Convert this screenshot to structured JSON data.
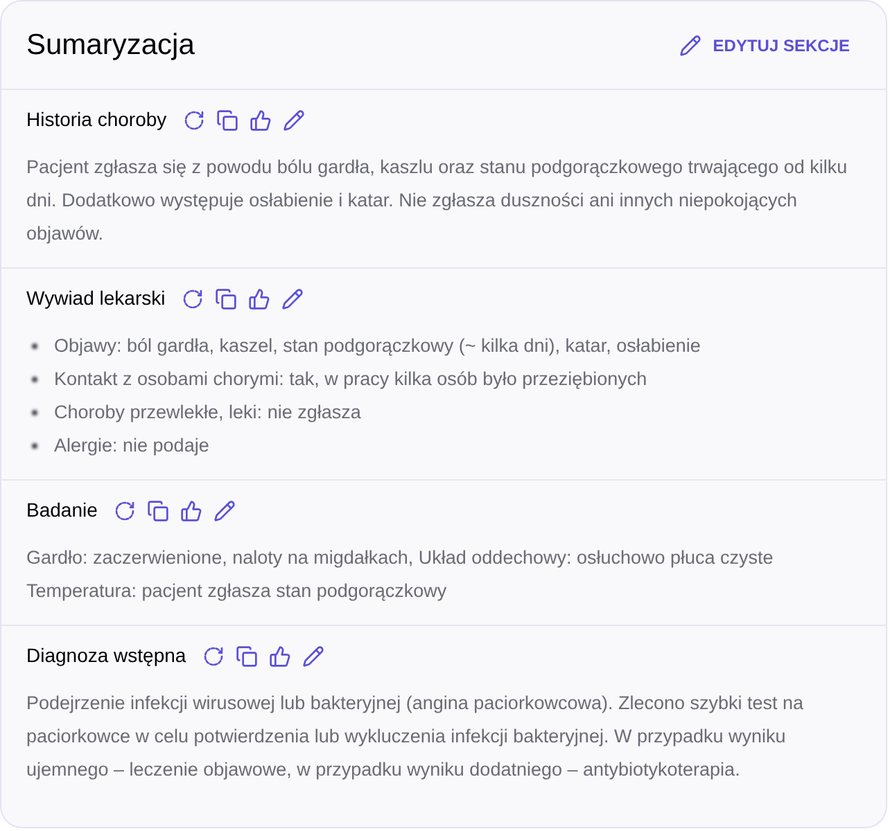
{
  "header": {
    "title": "Sumaryzacja",
    "edit_button": "EDYTUJ SEKCJE"
  },
  "sections": [
    {
      "title": "Historia choroby",
      "kind": "paragraph",
      "text": "Pacjent zgłasza się z powodu bólu gardła, kaszlu oraz stanu podgorączkowego trwającego od kilku dni. Dodatkowo występuje osłabienie i katar. Nie zgłasza duszności ani innych niepokojących objawów."
    },
    {
      "title": "Wywiad lekarski",
      "kind": "list",
      "items": [
        "Objawy: ból gardła, kaszel, stan podgorączkowy (~ kilka dni), katar, osłabienie",
        "Kontakt z osobami chorymi: tak, w pracy kilka osób było przeziębionych",
        "Choroby przewlekłe, leki: nie zgłasza",
        "Alergie: nie podaje"
      ]
    },
    {
      "title": "Badanie",
      "kind": "lines",
      "items": [
        "Gardło: zaczerwienione, naloty na migdałkach, Układ oddechowy: osłuchowo płuca czyste",
        "Temperatura: pacjent zgłasza stan podgorączkowy"
      ]
    },
    {
      "title": "Diagnoza wstępna",
      "kind": "paragraph",
      "text": "Podejrzenie infekcji wirusowej lub bakteryjnej (angina paciorkowcowa). Zlecono szybki test na paciorkowce w celu potwierdzenia lub wykluczenia infekcji bakteryjnej. W przypadku wyniku ujemnego – leczenie objawowe, w przypadku wyniku dodatniego – antybiotykoterapia."
    }
  ]
}
